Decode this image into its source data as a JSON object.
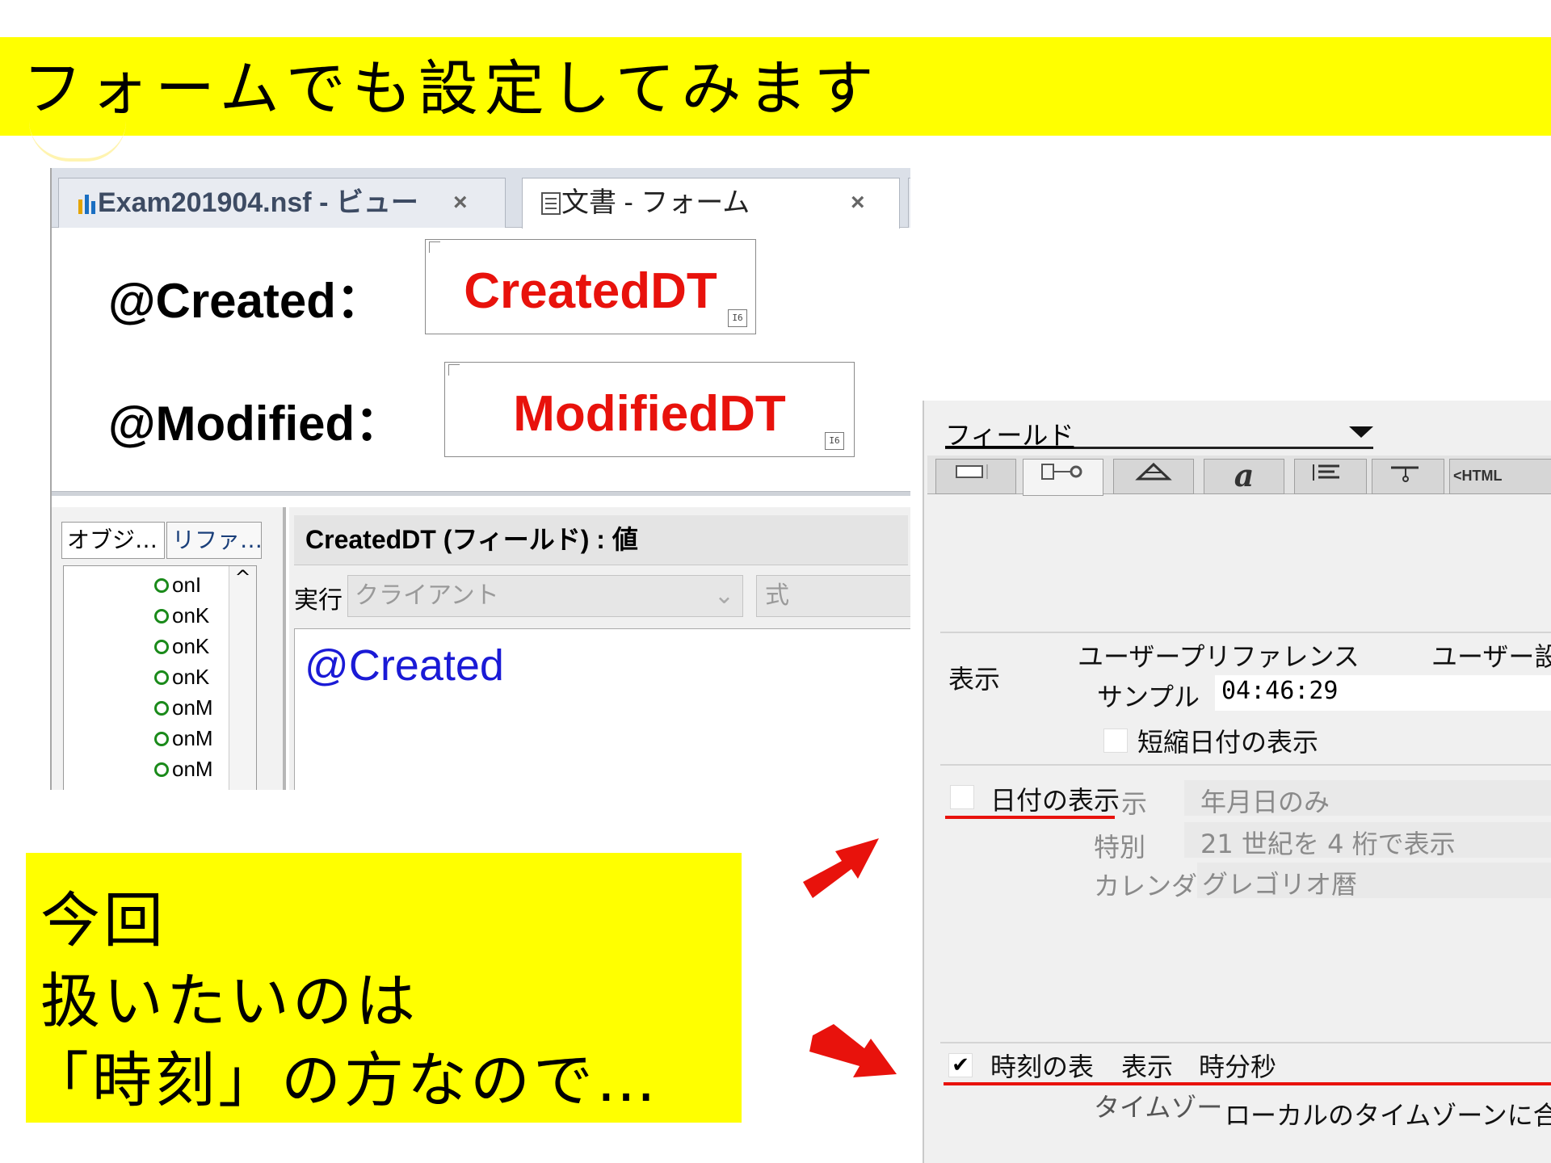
{
  "slide": {
    "title": "フォームでも設定してみます",
    "callout_lines": [
      "今回",
      "扱いたいのは",
      "「時刻」の方なので…"
    ]
  },
  "designer": {
    "tabs": [
      {
        "label": "Exam201904.nsf - ビュー",
        "close": "×",
        "icon": "database-icon"
      },
      {
        "label": "文書 - フォーム",
        "close": "×",
        "icon": "form-icon"
      },
      {
        "label": "",
        "icon": "view-icon"
      }
    ],
    "form": {
      "created_label": "@Created：",
      "created_field": "CreatedDT",
      "modified_label": "@Modified：",
      "modified_field": "ModifiedDT",
      "field_badge": "I6"
    },
    "objects": {
      "tab_objects": "オブジ…",
      "tab_reference": "リファ…",
      "items": [
        "onI",
        "onK",
        "onK",
        "onK",
        "onM",
        "onM",
        "onM"
      ]
    },
    "programmer": {
      "header": "CreatedDT (フィールド) : 値",
      "run_label": "実行",
      "run_target": "クライアント",
      "run_type": "式",
      "code": "@Created"
    }
  },
  "properties": {
    "selector": "フィールド",
    "tabs": [
      "",
      "",
      "",
      "a",
      "",
      "",
      "<HTML"
    ],
    "display_label": "表示",
    "user_pref": "ユーザープリファレンス",
    "user_setting": "ユーザー設",
    "sample_label": "サンプル",
    "sample_value": "04:46:29",
    "short_date": "短縮日付の表示",
    "date_display": "日付の表示",
    "date_display_ghost": "示",
    "date_format": "年月日のみ",
    "special_label": "特別",
    "special_value": "21 世紀を 4 桁で表示",
    "calendar_label": "カレンダ",
    "calendar_value": "グレゴリオ暦",
    "time_display": "時刻の表",
    "time_display_ghost": "表示",
    "time_checked": true,
    "time_format": "時分秒",
    "timezone_label": "タイムゾー",
    "timezone_value": "ローカルのタイムゾーンに合"
  },
  "colors": {
    "highlight": "#ffff00",
    "field_name": "#e8120c",
    "formula": "#1a1ad6",
    "underline": "#e8120c",
    "arrow": "#e8120c"
  }
}
